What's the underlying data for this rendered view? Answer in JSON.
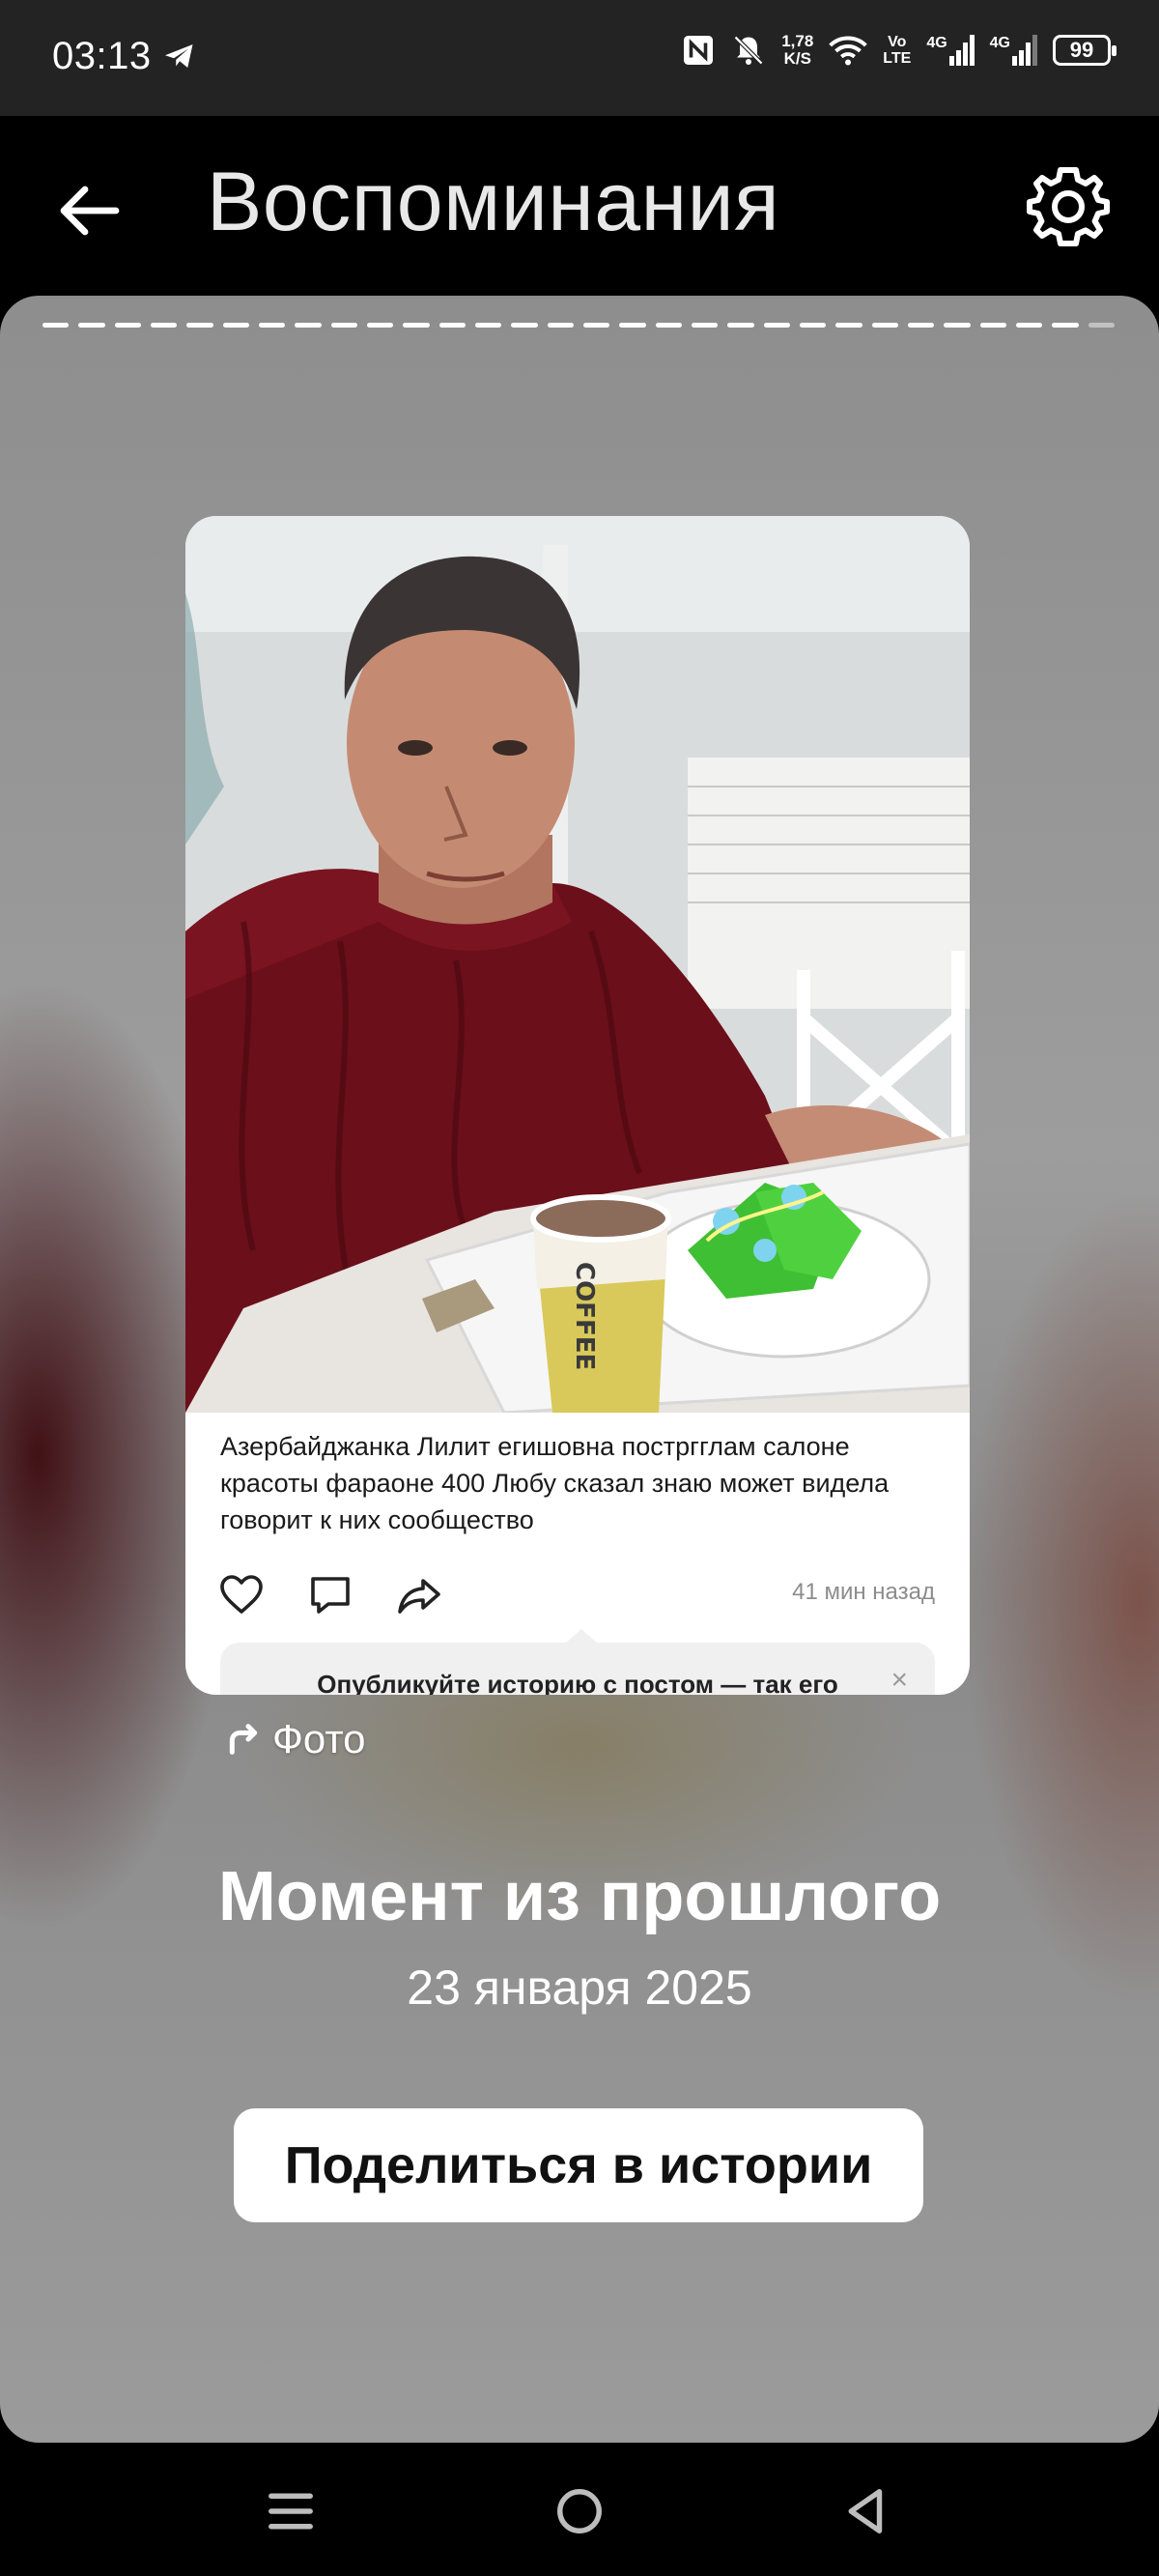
{
  "status_bar": {
    "time": "03:13",
    "net_speed_value": "1,78",
    "net_speed_unit": "K/S",
    "volte_top": "Vo",
    "volte_bottom": "LTE",
    "net1": "4G",
    "net2": "4G",
    "battery": "99"
  },
  "header": {
    "title": "Воспоминания",
    "icons": [
      "back-arrow-icon",
      "gear-icon"
    ]
  },
  "story": {
    "progress_segments_total": 30,
    "progress_segments_viewed": 29,
    "post": {
      "text": "Азербайджанка Лилит егишовна постргглам салоне красоты фараоне 400 Любу сказал знаю может видела говорит к них сообщество",
      "time_ago": "41 мин назад",
      "hint_text": "Опубликуйте историю с постом — так его",
      "hint_close": "×"
    },
    "photo_link": "Фото",
    "moment_title": "Момент из прошлого",
    "moment_date": "23 января 2025",
    "share_button": "Поделиться в истории"
  },
  "colors": {
    "statusbar_bg": "#232323",
    "header_bg": "#000000",
    "button_bg": "#ffffff"
  }
}
